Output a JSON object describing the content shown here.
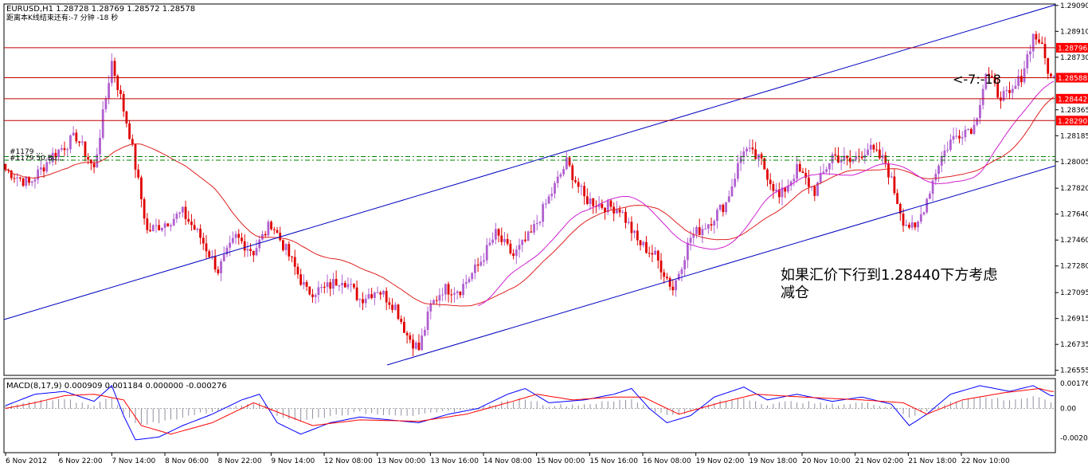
{
  "header": {
    "symbol_line": "EURUSD,H1  1.28728 1.28769 1.28572 1.28578",
    "countdown_line": "距离本K线结束还有:-7 分钟 -18 秒"
  },
  "annotation": {
    "line1": "如果汇价下行到1.28440下方考虑",
    "line2": "减仓"
  },
  "countdown_label": "<-7:-18",
  "left_overlay_labels": [
    "#1179 ...",
    "#1179 50 Bu..."
  ],
  "colors": {
    "bull": "#b060d0",
    "bear": "#e00000",
    "ma_slow": "#e02020",
    "ma_fast": "#d020d0",
    "channel": "#0000c0",
    "hline": "#c00000",
    "dashline": "#008000",
    "label_bg": "#ff0000",
    "macd_line": "#0000ff",
    "macd_signal": "#ff0000",
    "macd_hist": "#9090a0"
  },
  "chart_data": [
    {
      "type": "candlestick",
      "symbol": "EURUSD",
      "timeframe": "H1",
      "ylim": [
        1.2652,
        1.291
      ],
      "y_ticks": [
        "1.29090",
        "1.28910",
        "1.28730",
        "1.28365",
        "1.28185",
        "1.28005",
        "1.27820",
        "1.27640",
        "1.27460",
        "1.27280",
        "1.27095",
        "1.26915",
        "1.26735",
        "1.26555"
      ],
      "x_ticks": [
        "6 Nov 2012",
        "6 Nov 22:00",
        "7 Nov 14:00",
        "8 Nov 06:00",
        "8 Nov 22:00",
        "9 Nov 14:00",
        "12 Nov 08:00",
        "13 Nov 00:00",
        "13 Nov 16:00",
        "14 Nov 08:00",
        "15 Nov 00:00",
        "15 Nov 16:00",
        "16 Nov 08:00",
        "19 Nov 02:00",
        "19 Nov 18:00",
        "20 Nov 10:00",
        "21 Nov 02:00",
        "21 Nov 18:00",
        "22 Nov 10:00"
      ],
      "price_labels": [
        {
          "price": 1.28796,
          "text": "1.28796"
        },
        {
          "price": 1.28588,
          "text": "1.28588"
        },
        {
          "price": 1.28442,
          "text": "1.28442"
        },
        {
          "price": 1.2829,
          "text": "1.28290"
        }
      ],
      "horizontal_lines": [
        1.28796,
        1.28588,
        1.28442,
        1.2829
      ],
      "dashed_lines": [
        1.2804,
        1.28015
      ],
      "close_path": [
        [
          0,
          1.2795
        ],
        [
          8,
          1.2785
        ],
        [
          16,
          1.2805
        ],
        [
          24,
          1.2818
        ],
        [
          30,
          1.2795
        ],
        [
          36,
          1.287
        ],
        [
          42,
          1.282
        ],
        [
          48,
          1.2752
        ],
        [
          54,
          1.2758
        ],
        [
          60,
          1.2765
        ],
        [
          66,
          1.2748
        ],
        [
          72,
          1.2725
        ],
        [
          78,
          1.2748
        ],
        [
          84,
          1.2738
        ],
        [
          90,
          1.2758
        ],
        [
          96,
          1.2735
        ],
        [
          102,
          1.271
        ],
        [
          108,
          1.2712
        ],
        [
          114,
          1.272
        ],
        [
          120,
          1.2705
        ],
        [
          126,
          1.2712
        ],
        [
          132,
          1.27
        ],
        [
          136,
          1.268
        ],
        [
          140,
          1.267
        ],
        [
          144,
          1.27
        ],
        [
          148,
          1.2712
        ],
        [
          154,
          1.2712
        ],
        [
          160,
          1.2728
        ],
        [
          166,
          1.275
        ],
        [
          172,
          1.2735
        ],
        [
          178,
          1.275
        ],
        [
          184,
          1.2775
        ],
        [
          190,
          1.28
        ],
        [
          196,
          1.2775
        ],
        [
          202,
          1.277
        ],
        [
          208,
          1.2768
        ],
        [
          214,
          1.2745
        ],
        [
          220,
          1.2735
        ],
        [
          226,
          1.2712
        ],
        [
          232,
          1.2748
        ],
        [
          238,
          1.2758
        ],
        [
          244,
          1.2772
        ],
        [
          250,
          1.281
        ],
        [
          256,
          1.28
        ],
        [
          262,
          1.2775
        ],
        [
          268,
          1.2795
        ],
        [
          274,
          1.278
        ],
        [
          280,
          1.2805
        ],
        [
          286,
          1.28
        ],
        [
          292,
          1.281
        ],
        [
          298,
          1.28
        ],
        [
          304,
          1.276
        ],
        [
          308,
          1.2752
        ],
        [
          312,
          1.2775
        ],
        [
          316,
          1.28
        ],
        [
          320,
          1.2815
        ],
        [
          324,
          1.2822
        ],
        [
          328,
          1.2825
        ],
        [
          332,
          1.2862
        ],
        [
          336,
          1.2848
        ],
        [
          340,
          1.2845
        ],
        [
          344,
          1.286
        ],
        [
          348,
          1.2888
        ],
        [
          350,
          1.2885
        ],
        [
          354,
          1.2858
        ]
      ]
    },
    {
      "type": "line",
      "name": "MACD(8,17,9) 0.000909 0.001184 0.000000 -0.000276",
      "ylim": [
        -0.0031,
        0.0021
      ],
      "y_ticks": [
        "0.001766",
        "0.00",
        "-0.00207"
      ],
      "series": [
        {
          "name": "MACD",
          "values": [
            [
              0,
              0.0002
            ],
            [
              10,
              0.001
            ],
            [
              20,
              0.0012
            ],
            [
              30,
              0.0005
            ],
            [
              36,
              0.0016
            ],
            [
              40,
              -0.0005
            ],
            [
              44,
              -0.0022
            ],
            [
              52,
              -0.002
            ],
            [
              60,
              -0.0012
            ],
            [
              70,
              -0.0004
            ],
            [
              80,
              0.0006
            ],
            [
              86,
              0.001
            ],
            [
              92,
              -0.001
            ],
            [
              100,
              -0.0018
            ],
            [
              110,
              -0.001
            ],
            [
              120,
              -0.0006
            ],
            [
              130,
              -0.0008
            ],
            [
              140,
              -0.001
            ],
            [
              150,
              -0.0004
            ],
            [
              160,
              0.0
            ],
            [
              170,
              0.001
            ],
            [
              176,
              0.0014
            ],
            [
              184,
              0.0004
            ],
            [
              196,
              0.0006
            ],
            [
              206,
              0.001
            ],
            [
              212,
              0.0014
            ],
            [
              218,
              0.0
            ],
            [
              224,
              -0.001
            ],
            [
              232,
              -0.0005
            ],
            [
              240,
              0.0008
            ],
            [
              250,
              0.0015
            ],
            [
              258,
              0.0006
            ],
            [
              268,
              0.001
            ],
            [
              280,
              0.0005
            ],
            [
              290,
              0.0008
            ],
            [
              300,
              0.0003
            ],
            [
              306,
              -0.0012
            ],
            [
              312,
              -0.0004
            ],
            [
              320,
              0.001
            ],
            [
              330,
              0.0016
            ],
            [
              340,
              0.0012
            ],
            [
              348,
              0.0016
            ],
            [
              354,
              0.0009
            ]
          ]
        },
        {
          "name": "Signal",
          "values": [
            [
              0,
              0.0
            ],
            [
              10,
              0.0004
            ],
            [
              20,
              0.0009
            ],
            [
              30,
              0.001
            ],
            [
              40,
              0.0006
            ],
            [
              46,
              -0.0012
            ],
            [
              56,
              -0.0018
            ],
            [
              70,
              -0.001
            ],
            [
              84,
              0.0004
            ],
            [
              94,
              -0.0004
            ],
            [
              104,
              -0.0012
            ],
            [
              120,
              -0.0008
            ],
            [
              140,
              -0.0009
            ],
            [
              156,
              -0.0004
            ],
            [
              170,
              0.0004
            ],
            [
              180,
              0.001
            ],
            [
              192,
              0.0006
            ],
            [
              206,
              0.0008
            ],
            [
              216,
              0.0008
            ],
            [
              228,
              -0.0004
            ],
            [
              242,
              0.0004
            ],
            [
              254,
              0.001
            ],
            [
              270,
              0.0008
            ],
            [
              290,
              0.0006
            ],
            [
              304,
              0.0004
            ],
            [
              312,
              -0.0004
            ],
            [
              324,
              0.0006
            ],
            [
              338,
              0.0011
            ],
            [
              350,
              0.0014
            ],
            [
              354,
              0.0012
            ]
          ]
        }
      ]
    }
  ]
}
